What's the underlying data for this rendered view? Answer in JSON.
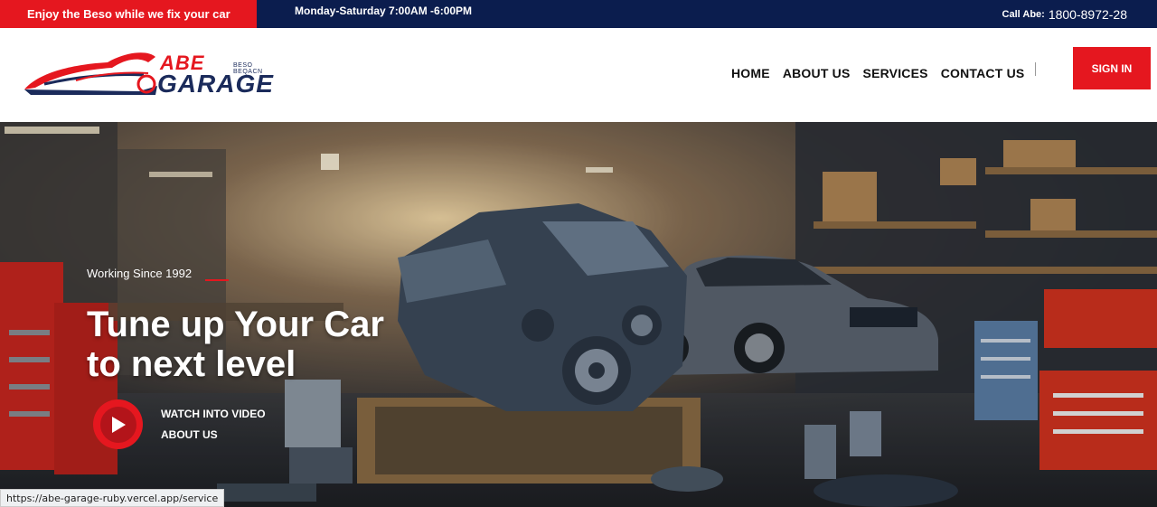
{
  "topbar": {
    "promo": "Enjoy the Beso while we fix your car",
    "hours": "Monday-Saturday 7:00AM -6:00PM",
    "call_label": "Call Abe:",
    "call_number": "1800-8972-28"
  },
  "logo": {
    "brand_top": "ABE",
    "brand_bottom": "GARAGE",
    "tagline": "BESO BEQACN"
  },
  "nav": {
    "items": [
      "HOME",
      "ABOUT US",
      "SERVICES",
      "CONTACT US"
    ],
    "signin": "SIGN IN"
  },
  "hero": {
    "since": "Working Since 1992",
    "headline_1": "Tune up Your Car",
    "headline_2": "to next level",
    "video_1": "WATCH INTO VIDEO",
    "video_2": "ABOUT US"
  },
  "status_url": "https://abe-garage-ruby.vercel.app/service",
  "colors": {
    "accent": "#e5171f",
    "navy": "#0b1d4e"
  }
}
